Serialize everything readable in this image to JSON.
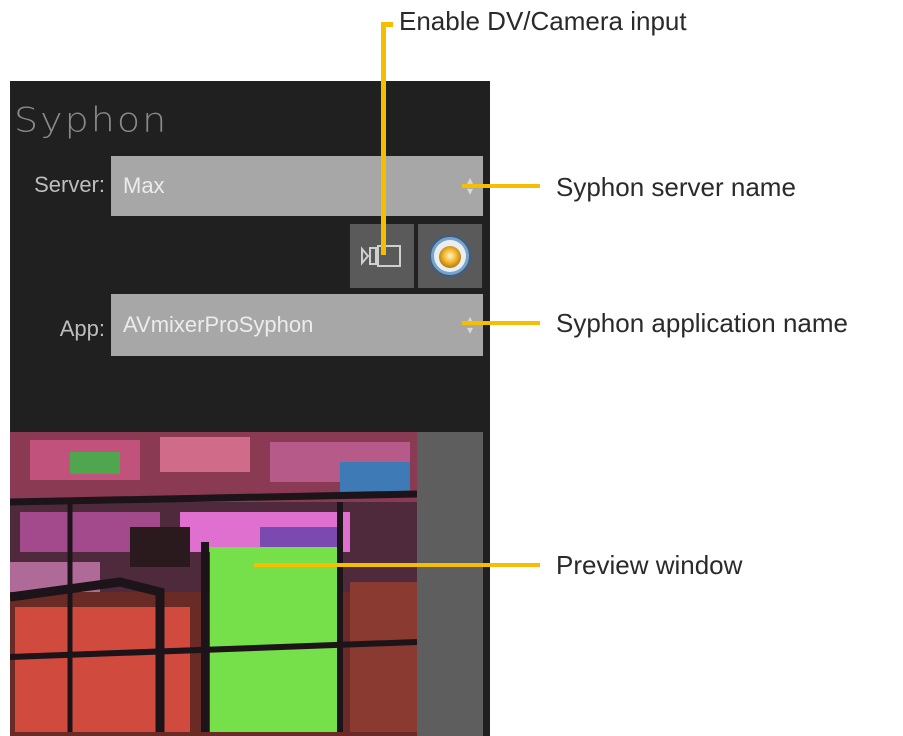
{
  "panel": {
    "title": "Syphon",
    "server_label": "Server:",
    "server_value": "Max",
    "app_label": "App:",
    "app_value": "AVmixerProSyphon"
  },
  "icons": {
    "camera": "camera-input-icon",
    "syphon": "syphon-logo-icon",
    "arrows": "stepper-arrows-icon"
  },
  "callouts": {
    "camera_input": "Enable DV/Camera input",
    "server_name": "Syphon server name",
    "app_name": "Syphon application name",
    "preview": "Preview window"
  },
  "colors": {
    "panel_bg": "#202020",
    "select_bg": "#a7a7a7",
    "callout": "#f5be00"
  }
}
